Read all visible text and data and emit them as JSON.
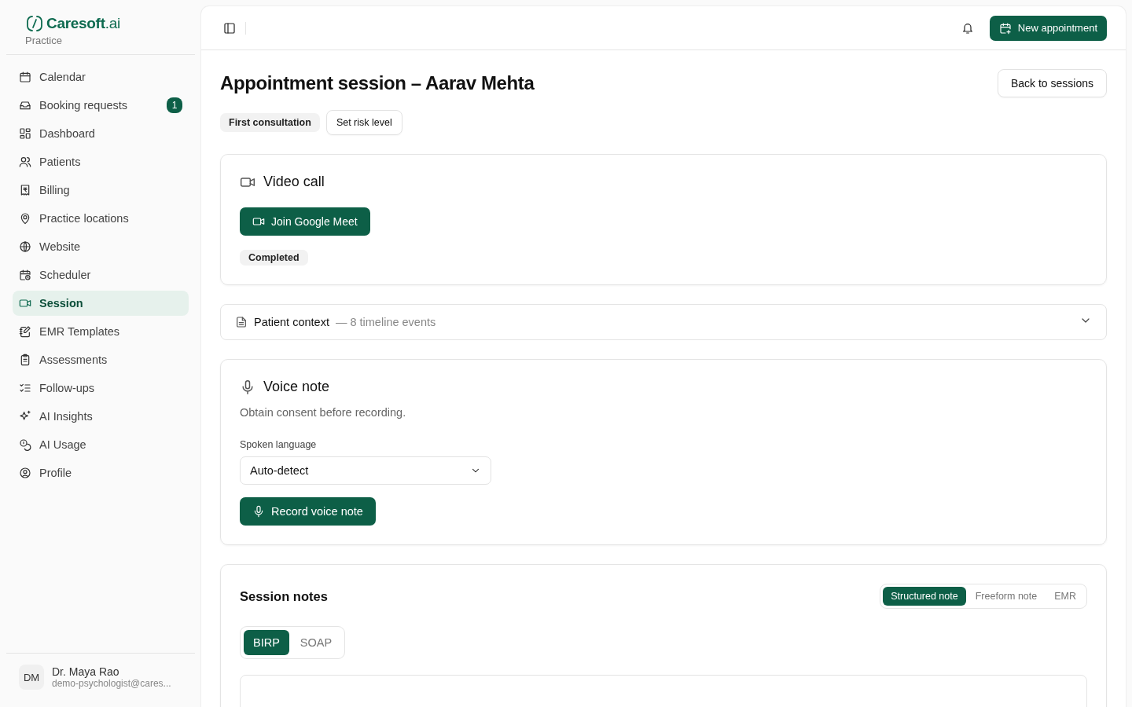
{
  "brand": {
    "name": "Caresoft",
    "suffix": ".ai",
    "subtitle": "Practice"
  },
  "nav": [
    {
      "label": "Calendar",
      "selected": false
    },
    {
      "label": "Booking requests",
      "selected": false,
      "badge": "1"
    },
    {
      "label": "Dashboard",
      "selected": false
    },
    {
      "label": "Patients",
      "selected": false
    },
    {
      "label": "Billing",
      "selected": false
    },
    {
      "label": "Practice locations",
      "selected": false
    },
    {
      "label": "Website",
      "selected": false
    },
    {
      "label": "Scheduler",
      "selected": false
    },
    {
      "label": "Session",
      "selected": true
    },
    {
      "label": "EMR Templates",
      "selected": false
    },
    {
      "label": "Assessments",
      "selected": false
    },
    {
      "label": "Follow-ups",
      "selected": false
    },
    {
      "label": "AI Insights",
      "selected": false
    },
    {
      "label": "AI Usage",
      "selected": false
    },
    {
      "label": "Profile",
      "selected": false
    }
  ],
  "user": {
    "initials": "DM",
    "name": "Dr. Maya Rao",
    "email": "demo-psychologist@cares..."
  },
  "topbar": {
    "new_button": "New appointment"
  },
  "page": {
    "title": "Appointment session – Aarav Mehta",
    "back_button": "Back to sessions",
    "tag": "First consultation",
    "risk_button": "Set risk level"
  },
  "video": {
    "title": "Video call",
    "join_button": "Join Google Meet",
    "status": "Completed"
  },
  "context": {
    "title": "Patient context",
    "detail": "— 8 timeline events",
    "expanded": false
  },
  "voice": {
    "title": "Voice note",
    "hint": "Obtain consent before recording.",
    "language_label": "Spoken language",
    "language_value": "Auto-detect",
    "record_button": "Record voice note"
  },
  "notes": {
    "title": "Session notes",
    "modes": [
      {
        "label": "Structured note",
        "selected": true
      },
      {
        "label": "Freeform note",
        "selected": false
      },
      {
        "label": "EMR",
        "selected": false
      }
    ],
    "formats": [
      {
        "label": "BIRP",
        "selected": true
      },
      {
        "label": "SOAP",
        "selected": false
      }
    ]
  }
}
